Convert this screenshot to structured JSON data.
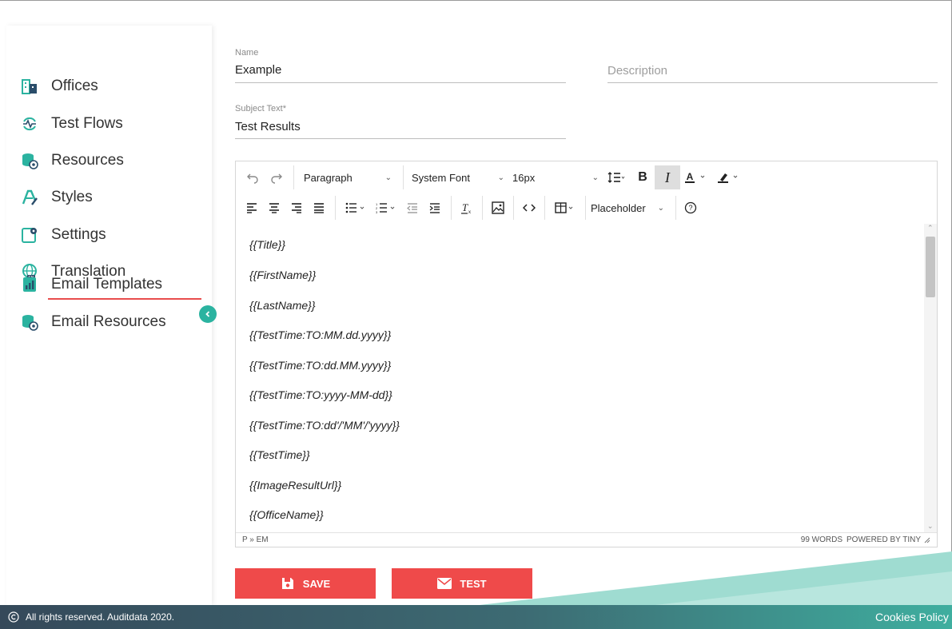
{
  "sidebar": {
    "items": [
      {
        "label": "Offices",
        "icon": "office-building-icon"
      },
      {
        "label": "Test Flows",
        "icon": "test-flow-icon"
      },
      {
        "label": "Resources",
        "icon": "database-icon"
      },
      {
        "label": "Styles",
        "icon": "brush-icon"
      },
      {
        "label": "Settings",
        "icon": "settings-icon"
      },
      {
        "label": "Translation",
        "icon": "globe-icon"
      },
      {
        "label": "Email Templates",
        "icon": "report-icon"
      },
      {
        "label": "Email Resources",
        "icon": "database-icon"
      }
    ],
    "active_item": "Email Templates"
  },
  "form": {
    "name": {
      "label": "Name",
      "value": "Example"
    },
    "description": {
      "placeholder": "Description"
    },
    "subject": {
      "label": "Subject Text*",
      "value": "Test Results"
    }
  },
  "editor": {
    "toolbar": {
      "block_format": "Paragraph",
      "font_family": "System Font",
      "font_size": "16px",
      "placeholder_menu": "Placeholder"
    },
    "paragraphs": [
      "{{Title}}",
      "{{FirstName}}",
      "{{LastName}}",
      "{{TestTime:TO:MM.dd.yyyy}}",
      "{{TestTime:TO:dd.MM.yyyy}}",
      "{{TestTime:TO:yyyy-MM-dd}}",
      "{{TestTime:TO:dd'/'MM'/'yyyy}}",
      "{{TestTime}}",
      "{{ImageResultUrl}}",
      "{{OfficeName}}"
    ],
    "status_path": "P » EM",
    "word_count": "99 WORDS",
    "powered_by": "POWERED BY TINY"
  },
  "actions": {
    "save_label": "SAVE",
    "test_label": "TEST"
  },
  "footer": {
    "copyright": "All rights reserved. Auditdata 2020.",
    "cookies": "Cookies Policy"
  },
  "colors": {
    "accent": "#2bb3a0",
    "danger": "#ef4a4a"
  }
}
